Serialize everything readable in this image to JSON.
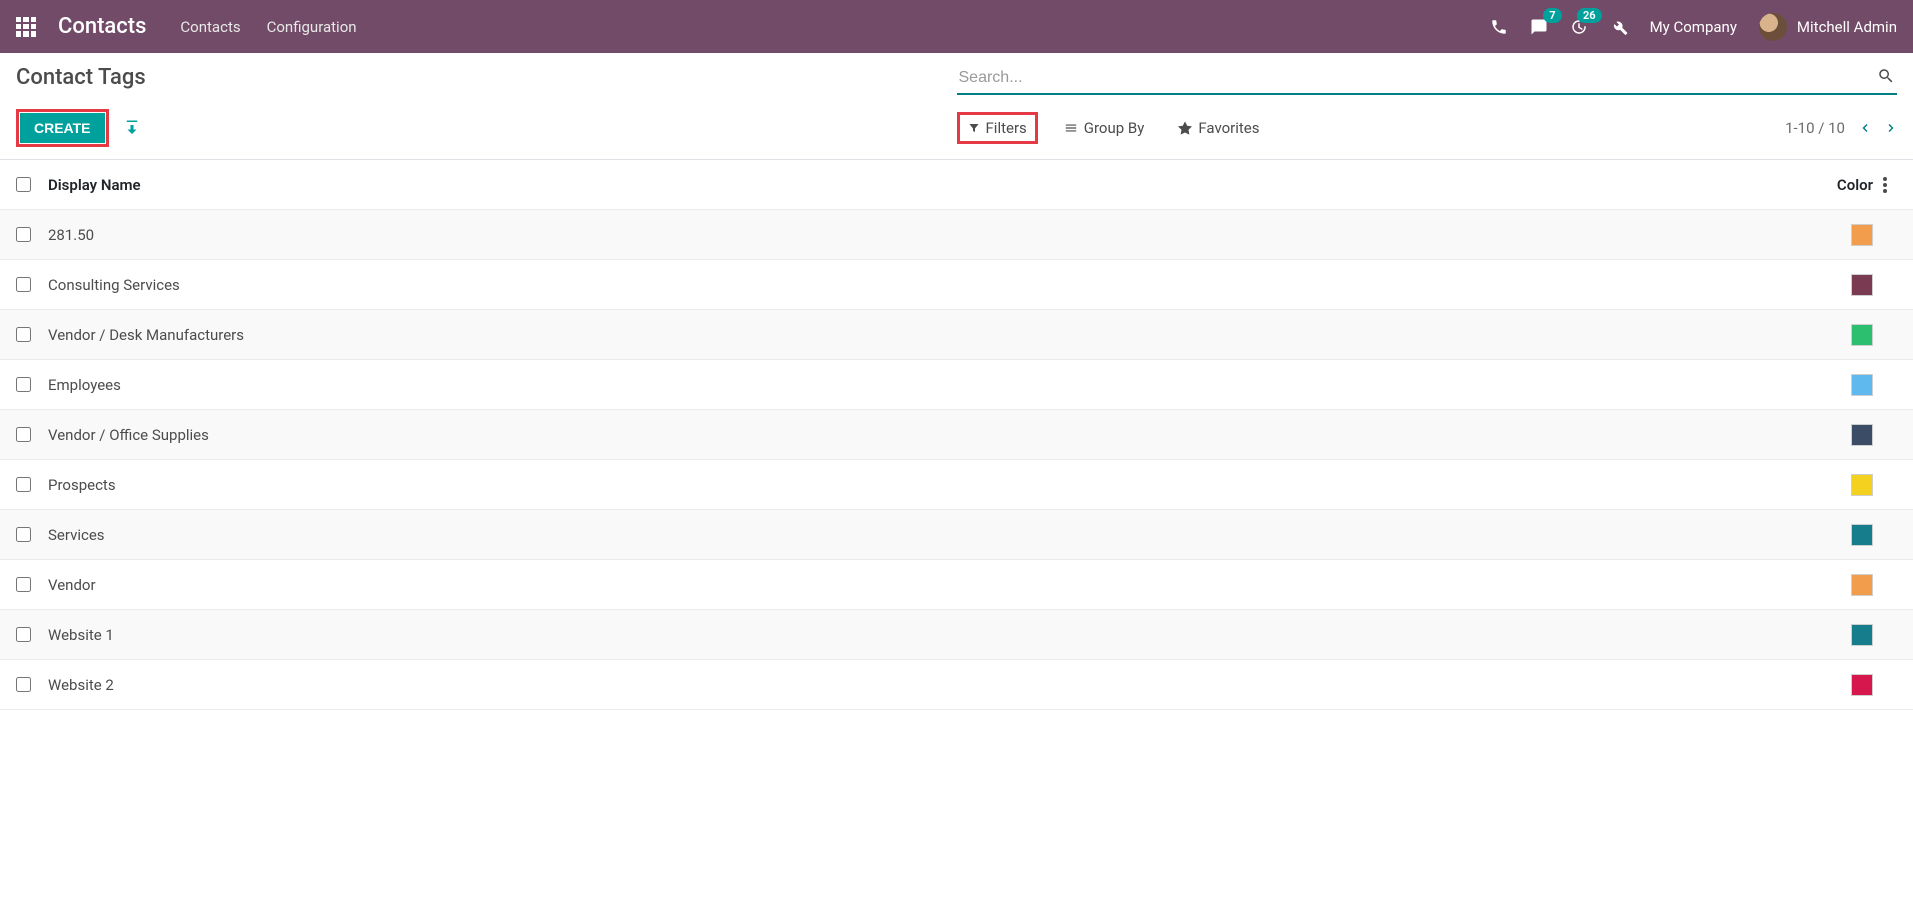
{
  "navbar": {
    "brand": "Contacts",
    "menu": [
      "Contacts",
      "Configuration"
    ],
    "messages_badge": "7",
    "activities_badge": "26",
    "company": "My Company",
    "user": "Mitchell Admin"
  },
  "breadcrumb": "Contact Tags",
  "buttons": {
    "create": "CREATE"
  },
  "search": {
    "placeholder": "Search..."
  },
  "search_options": {
    "filters": "Filters",
    "group_by": "Group By",
    "favorites": "Favorites"
  },
  "pager": {
    "range": "1-10 / 10"
  },
  "columns": {
    "name": "Display Name",
    "color": "Color"
  },
  "rows": [
    {
      "name": "281.50",
      "color": "#f29d4b"
    },
    {
      "name": "Consulting Services",
      "color": "#7a3b52"
    },
    {
      "name": "Vendor / Desk Manufacturers",
      "color": "#2dbf70"
    },
    {
      "name": "Employees",
      "color": "#5fb9ef"
    },
    {
      "name": "Vendor / Office Supplies",
      "color": "#3b4d66"
    },
    {
      "name": "Prospects",
      "color": "#f4d01f"
    },
    {
      "name": "Services",
      "color": "#157d8c"
    },
    {
      "name": "Vendor",
      "color": "#f29d4b"
    },
    {
      "name": "Website 1",
      "color": "#157d8c"
    },
    {
      "name": "Website 2",
      "color": "#d6174e"
    }
  ]
}
